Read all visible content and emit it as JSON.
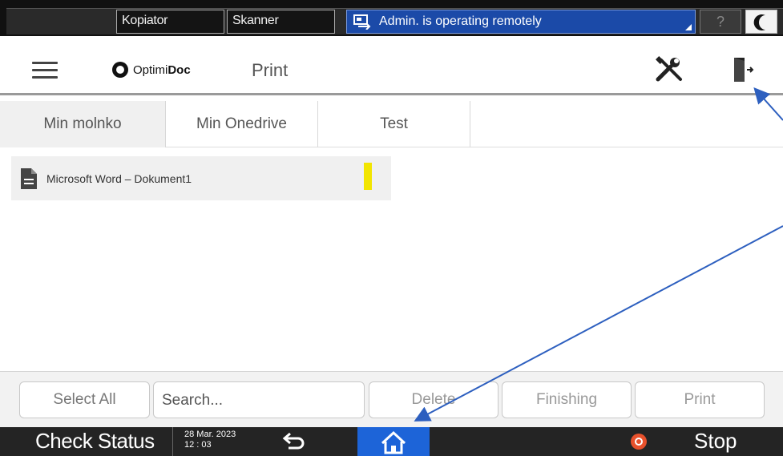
{
  "system_bar": {
    "copier_tab": "Kopiator",
    "scanner_tab": "Skanner",
    "remote_status": "Admin. is operating remotely",
    "help_label": "?"
  },
  "header": {
    "logo_prefix": "Optimi",
    "logo_bold": "Doc",
    "title": "Print"
  },
  "tabs": [
    {
      "label": "Min molnko",
      "active": true
    },
    {
      "label": "Min Onedrive",
      "active": false
    },
    {
      "label": "Test",
      "active": false
    }
  ],
  "files": [
    {
      "name": "Microsoft Word – Dokument1",
      "flag_color": "#f2e500"
    }
  ],
  "actions": {
    "select_all": "Select All",
    "search_placeholder": "Search...",
    "delete": "Delete",
    "finishing": "Finishing",
    "print": "Print"
  },
  "bottom_bar": {
    "check_status": "Check Status",
    "date": "28 Mar. 2023",
    "time": "12 : 03",
    "stop": "Stop"
  },
  "colors": {
    "accent_blue": "#1d64d8",
    "remote_banner": "#1b4aa8",
    "annotation_arrow": "#2d5fbf",
    "stop_red": "#e8512c"
  }
}
